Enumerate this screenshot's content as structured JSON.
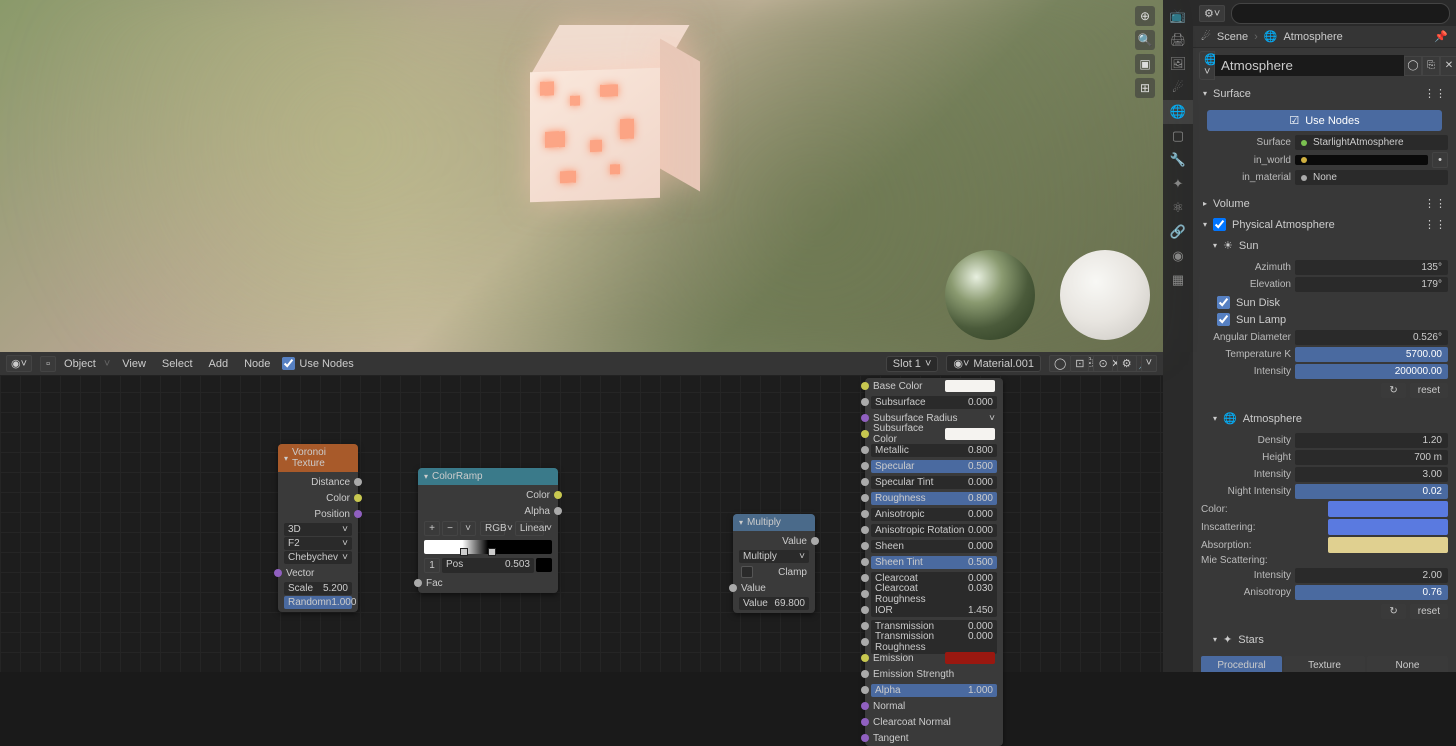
{
  "viewport": {
    "icons": [
      "⊕",
      "🔍",
      "📷",
      "⊞"
    ]
  },
  "node_editor": {
    "header": {
      "mode": "Object",
      "menus": [
        "View",
        "Select",
        "Add",
        "Node"
      ],
      "use_nodes_label": "Use Nodes",
      "slot": "Slot 1",
      "material": "Material.001"
    },
    "nodes": {
      "voronoi": {
        "title": "Voronoi Texture",
        "outputs": [
          "Distance",
          "Color",
          "Position"
        ],
        "dropdowns": [
          "3D",
          "F2",
          "Chebychev"
        ],
        "vector_in": "Vector",
        "scale_label": "Scale",
        "scale_val": "5.200",
        "random_label": "Randomn",
        "random_val": "1.000"
      },
      "colorramp": {
        "title": "ColorRamp",
        "outputs": [
          "Color",
          "Alpha"
        ],
        "ops": [
          "+",
          "−",
          "˅"
        ],
        "interp1": "RGB",
        "interp2": "Linear",
        "pos_idx": "1",
        "pos_label": "Pos",
        "pos_val": "0.503",
        "fac_in": "Fac"
      },
      "multiply": {
        "title": "Multiply",
        "outputs": [
          "Value"
        ],
        "type": "Multiply",
        "clamp": "Clamp",
        "value_in": "Value",
        "value_label": "Value",
        "value_val": "69.800"
      },
      "bsdf": {
        "rows": [
          {
            "label": "Base Color",
            "type": "color",
            "val": "#f5f3f0",
            "socket": "yellow"
          },
          {
            "label": "Subsurface",
            "type": "num",
            "val": "0.000",
            "socket": "grey"
          },
          {
            "label": "Subsurface Radius",
            "type": "dropdown",
            "val": "˅",
            "socket": "purple"
          },
          {
            "label": "Subsurface Color",
            "type": "color",
            "val": "#f5f3f0",
            "socket": "yellow"
          },
          {
            "label": "Metallic",
            "type": "num",
            "val": "0.800",
            "socket": "grey"
          },
          {
            "label": "Specular",
            "type": "numblue",
            "val": "0.500",
            "socket": "grey"
          },
          {
            "label": "Specular Tint",
            "type": "num",
            "val": "0.000",
            "socket": "grey"
          },
          {
            "label": "Roughness",
            "type": "numblue",
            "val": "0.800",
            "socket": "grey"
          },
          {
            "label": "Anisotropic",
            "type": "num",
            "val": "0.000",
            "socket": "grey"
          },
          {
            "label": "Anisotropic Rotation",
            "type": "num",
            "val": "0.000",
            "socket": "grey"
          },
          {
            "label": "Sheen",
            "type": "num",
            "val": "0.000",
            "socket": "grey"
          },
          {
            "label": "Sheen Tint",
            "type": "numblue",
            "val": "0.500",
            "socket": "grey"
          },
          {
            "label": "Clearcoat",
            "type": "num",
            "val": "0.000",
            "socket": "grey"
          },
          {
            "label": "Clearcoat Roughness",
            "type": "num",
            "val": "0.030",
            "socket": "grey"
          },
          {
            "label": "IOR",
            "type": "num",
            "val": "1.450",
            "socket": "grey"
          },
          {
            "label": "Transmission",
            "type": "num",
            "val": "0.000",
            "socket": "grey"
          },
          {
            "label": "Transmission Roughness",
            "type": "num",
            "val": "0.000",
            "socket": "grey"
          },
          {
            "label": "Emission",
            "type": "color",
            "val": "#9a1810",
            "socket": "yellow"
          },
          {
            "label": "Emission Strength",
            "type": "socket_only",
            "val": "",
            "socket": "grey"
          },
          {
            "label": "Alpha",
            "type": "numblue",
            "val": "1.000",
            "socket": "grey"
          },
          {
            "label": "Normal",
            "type": "socket_only",
            "val": "",
            "socket": "purple"
          },
          {
            "label": "Clearcoat Normal",
            "type": "socket_only",
            "val": "",
            "socket": "purple"
          },
          {
            "label": "Tangent",
            "type": "socket_only",
            "val": "",
            "socket": "purple"
          }
        ]
      }
    }
  },
  "properties": {
    "search_placeholder": "",
    "breadcrumb": {
      "scene": "Scene",
      "world": "Atmosphere"
    },
    "datablock": "Atmosphere",
    "surface_panel": "Surface",
    "use_nodes": "Use Nodes",
    "surface_label": "Surface",
    "surface_val": "StarlightAtmosphere",
    "in_world_label": "in_world",
    "in_material_label": "in_material",
    "in_material_val": "None",
    "volume_panel": "Volume",
    "phys_atmo_panel": "Physical Atmosphere",
    "sun_panel": "Sun",
    "sun": {
      "azimuth_label": "Azimuth",
      "azimuth_val": "135°",
      "elevation_label": "Elevation",
      "elevation_val": "179°",
      "sun_disk": "Sun Disk",
      "sun_lamp": "Sun Lamp",
      "ang_diam_label": "Angular Diameter",
      "ang_diam_val": "0.526°",
      "temp_label": "Temperature K",
      "temp_val": "5700.00",
      "intensity_label": "Intensity",
      "intensity_val": "200000.00"
    },
    "reset_label": "reset",
    "atmo_panel": "Atmosphere",
    "atmo": {
      "density_label": "Density",
      "density_val": "1.20",
      "height_label": "Height",
      "height_val": "700 m",
      "intensity_label": "Intensity",
      "intensity_val": "3.00",
      "night_label": "Night Intensity",
      "night_val": "0.02",
      "color_label": "Color:",
      "inscatter_label": "Inscattering:",
      "absorption_label": "Absorption:",
      "color_val": "#5a7ae0",
      "inscatter_val": "#5a7ae0",
      "absorption_val": "#e0d090",
      "mie_label": "Mie Scattering:",
      "mie_intensity_label": "Intensity",
      "mie_intensity_val": "2.00",
      "aniso_label": "Anisotropy",
      "aniso_val": "0.76"
    },
    "stars_panel": "Stars",
    "buttons": {
      "procedural": "Procedural",
      "texture": "Texture",
      "none": "None"
    }
  }
}
